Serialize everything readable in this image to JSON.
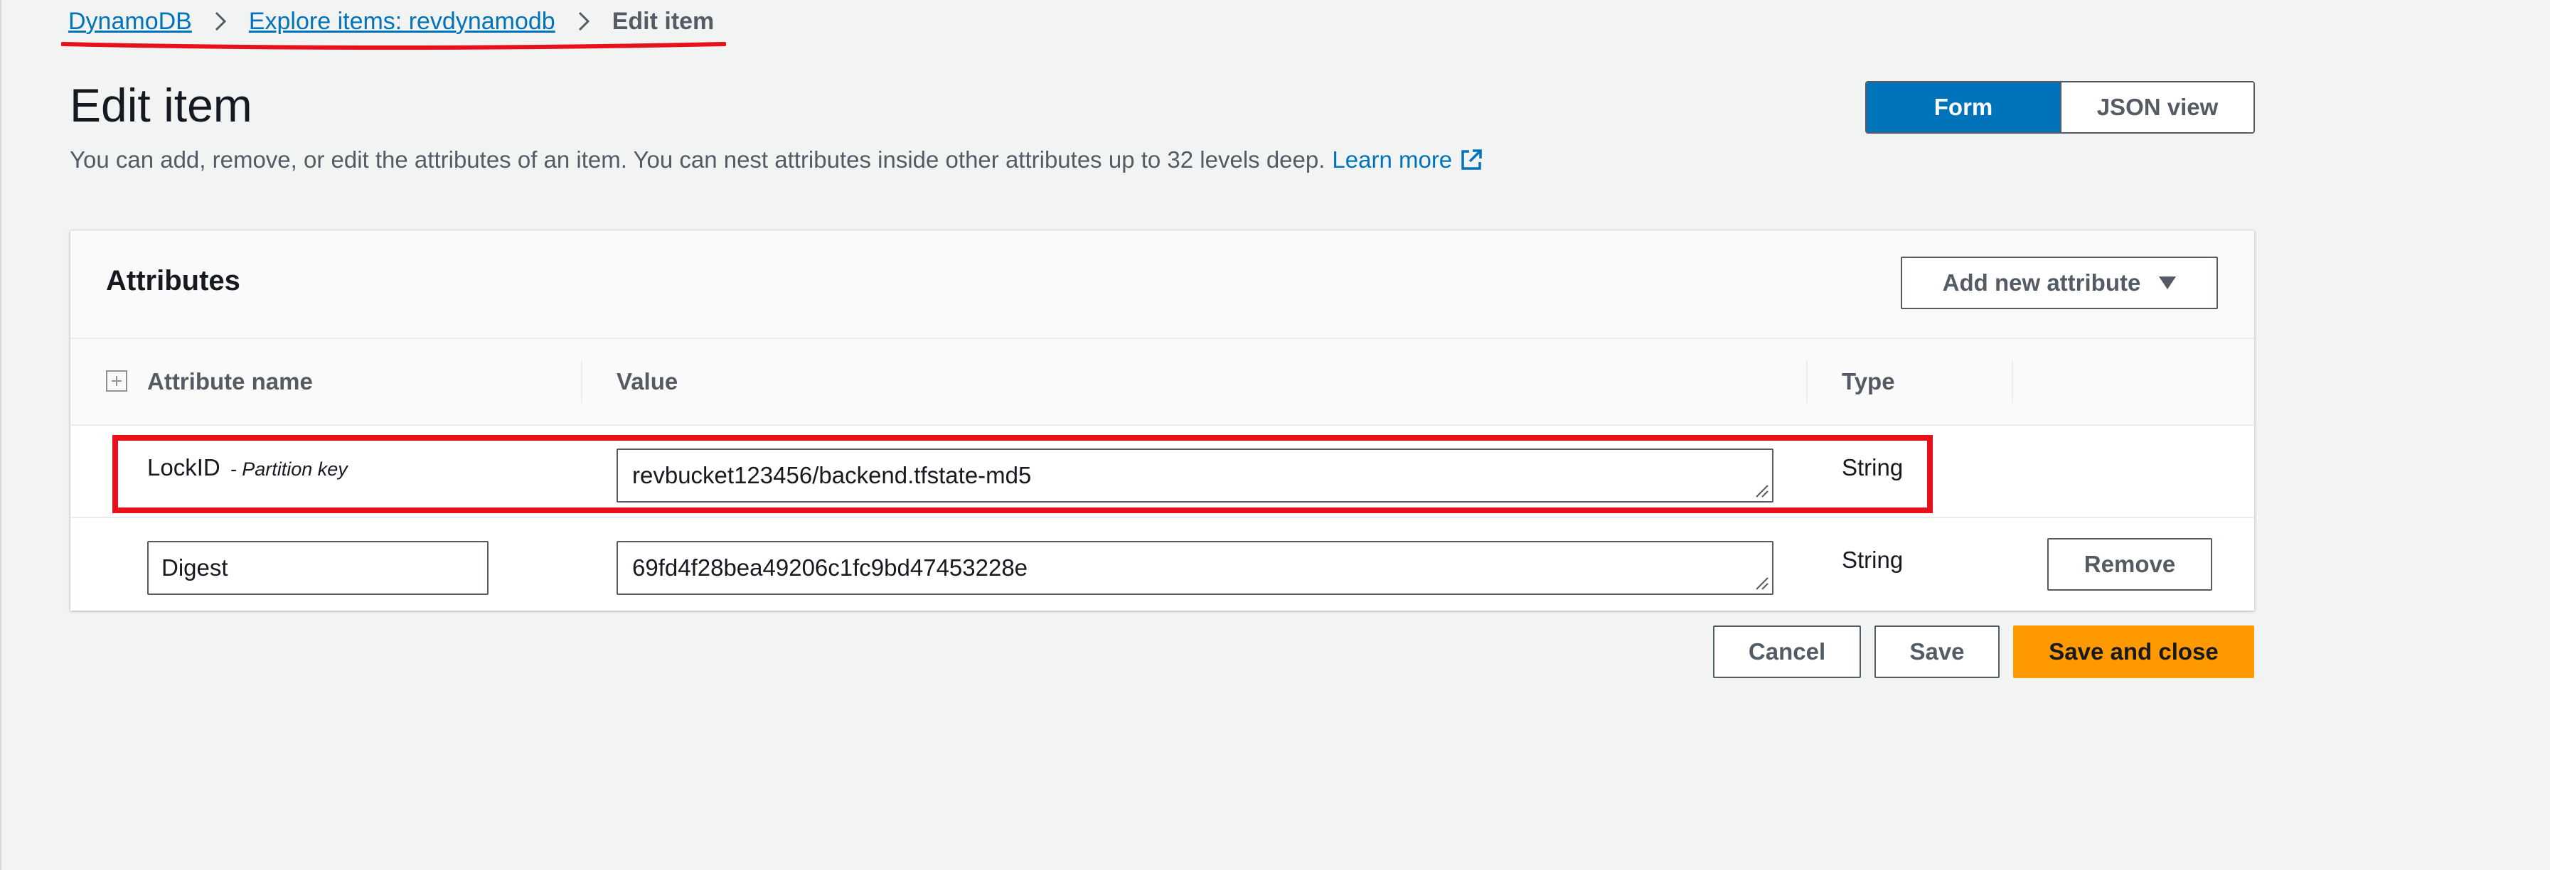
{
  "breadcrumb": {
    "items": [
      {
        "label": "DynamoDB"
      },
      {
        "label": "Explore items: revdynamodb"
      }
    ],
    "current": "Edit item"
  },
  "header": {
    "title": "Edit item",
    "description": "You can add, remove, or edit the attributes of an item. You can nest attributes inside other attributes up to 32 levels deep.",
    "learn_more": "Learn more"
  },
  "view_toggle": {
    "options": [
      {
        "label": "Form",
        "selected": true
      },
      {
        "label": "JSON view",
        "selected": false
      }
    ]
  },
  "attributes": {
    "title": "Attributes",
    "add_button": "Add new attribute",
    "columns": {
      "name": "Attribute name",
      "value": "Value",
      "type": "Type"
    },
    "rows": [
      {
        "name": "LockID",
        "key_label": "- Partition key",
        "value": "revbucket123456/backend.tfstate-md5",
        "type": "String"
      },
      {
        "name": "Digest",
        "value": "69fd4f28bea49206c1fc9bd47453228e",
        "type": "String",
        "remove_label": "Remove"
      }
    ]
  },
  "footer": {
    "cancel": "Cancel",
    "save": "Save",
    "save_close": "Save and close"
  },
  "colors": {
    "link": "#0073bb",
    "primary": "#ff9900",
    "annotation": "#e8101a"
  },
  "icons": {
    "breadcrumb_separator": "chevron-right-icon",
    "external_link": "external-link-icon",
    "dropdown": "caret-down-icon",
    "expand": "expand-all-icon",
    "resize": "resize-grip-icon"
  }
}
